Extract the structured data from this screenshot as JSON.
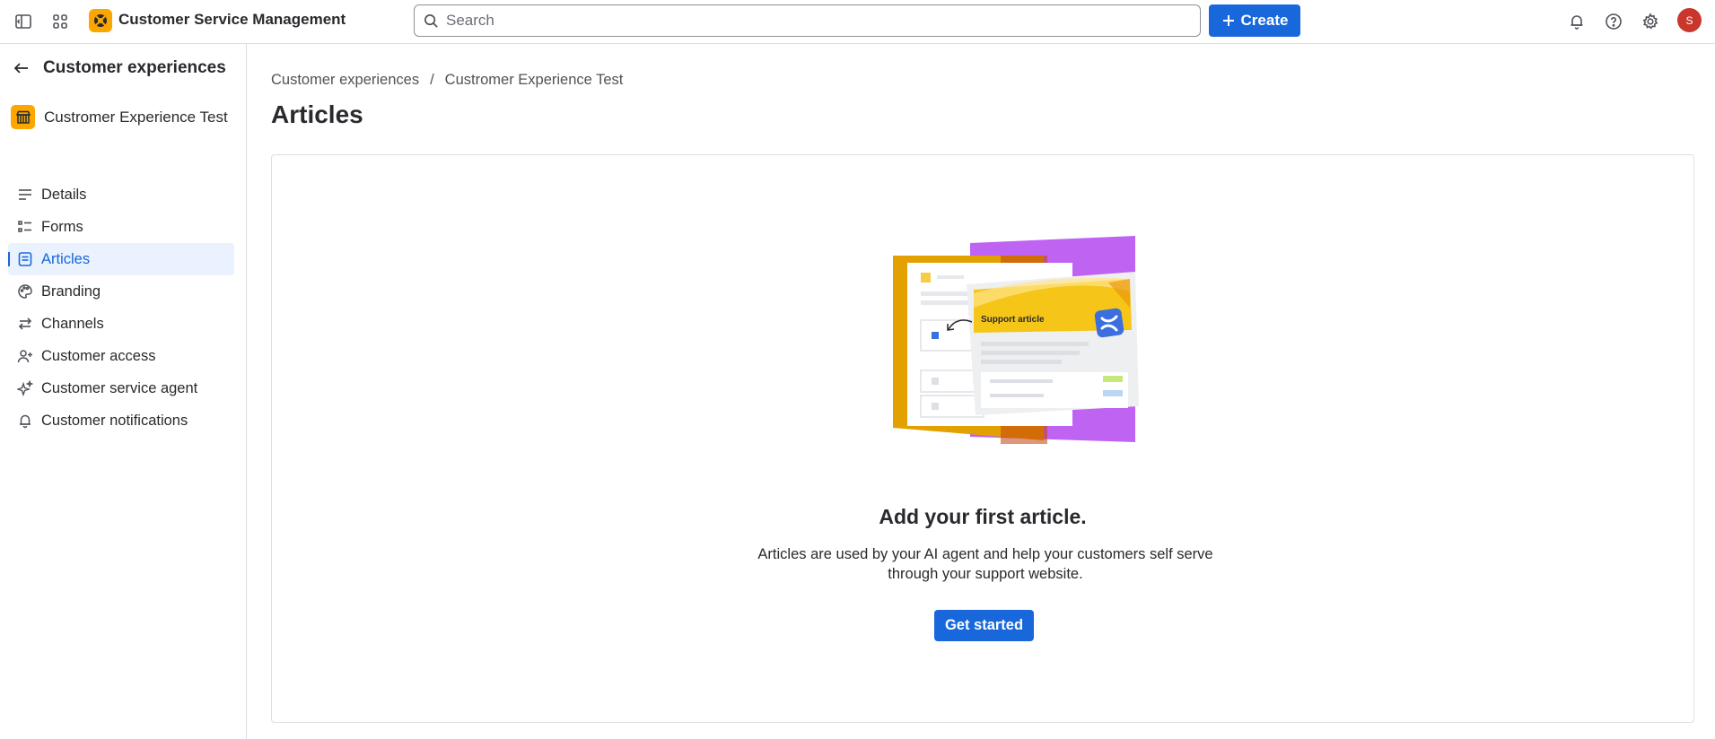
{
  "app": {
    "name": "Customer Service Management"
  },
  "search": {
    "placeholder": "Search"
  },
  "header": {
    "create_label": "Create",
    "avatar_initial": "S"
  },
  "sidebar": {
    "back_title": "Customer experiences",
    "space_name": "Custromer Experience Test",
    "items": [
      {
        "label": "Details",
        "icon": "lines-icon"
      },
      {
        "label": "Forms",
        "icon": "list-icon"
      },
      {
        "label": "Articles",
        "icon": "article-icon",
        "active": true
      },
      {
        "label": "Branding",
        "icon": "palette-icon"
      },
      {
        "label": "Channels",
        "icon": "arrows-swap-icon"
      },
      {
        "label": "Customer access",
        "icon": "person-add-icon"
      },
      {
        "label": "Customer service agent",
        "icon": "sparkle-icon"
      },
      {
        "label": "Customer notifications",
        "icon": "bell-icon"
      }
    ]
  },
  "breadcrumb": {
    "items": [
      "Customer experiences",
      "Custromer Experience Test"
    ],
    "separator": "/"
  },
  "page": {
    "title": "Articles"
  },
  "empty_state": {
    "illustration_label": "Support article",
    "title": "Add your first article.",
    "description": "Articles are used by your AI agent and help your customers self serve through your support website.",
    "button_label": "Get started"
  },
  "colors": {
    "primary": "#1868db",
    "brand_yellow": "#fca700",
    "avatar": "#c9372c",
    "illus_purple": "#bf63f3",
    "illus_orange": "#e2a100"
  }
}
